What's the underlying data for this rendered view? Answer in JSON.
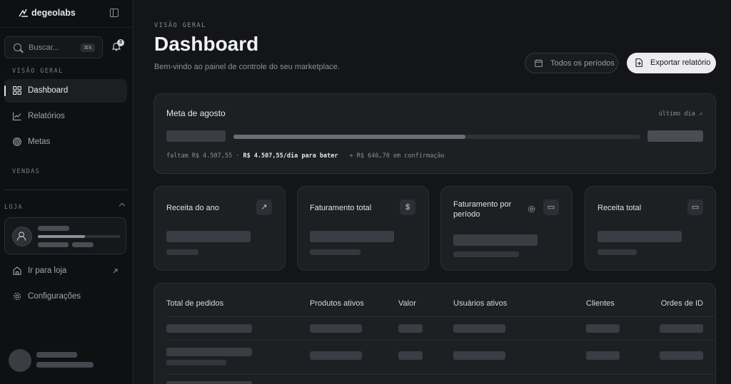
{
  "brand": {
    "name": "degeolabs"
  },
  "search": {
    "placeholder": "Buscar...",
    "shortcut": "⌘K"
  },
  "notifications": {
    "count": "3"
  },
  "sidebar": {
    "section_overview": "VISÃO GERAL",
    "items": [
      {
        "label": "Dashboard",
        "icon": "grid-icon",
        "active": true
      },
      {
        "label": "Relatórios",
        "icon": "chart-icon"
      },
      {
        "label": "Metas",
        "icon": "target-icon"
      }
    ],
    "section_sales": "VENDAS",
    "section_store": "LOJA",
    "footer_items": [
      {
        "label": "Ir para loja",
        "icon": "home-icon"
      },
      {
        "label": "Configurações",
        "icon": "gear-icon"
      }
    ]
  },
  "header": {
    "eyebrow": "VISÃO GERAL",
    "title": "Dashboard",
    "subtitle": "Bem-vindo ao painel de controle do seu marketplace.",
    "period_button": "Todos os períodos",
    "export_button": "Exportar relatório"
  },
  "goal": {
    "title": "Meta de agosto",
    "link": "último dia ↗",
    "progress": 0.57,
    "remaining_prefix": "faltam R$ 4.507,55 · ",
    "per_day": "R$ 4.507,55/dia para bater",
    "confirming": "+ R$ 646,70 em confirmação"
  },
  "stats": [
    {
      "title": "Receita do ano",
      "icon": "trend-up-icon",
      "glyph": "↗"
    },
    {
      "title": "Faturamento total",
      "icon": "dollar-icon",
      "glyph": "$"
    },
    {
      "title": "Faturamento por período",
      "icon": "card-icon",
      "glyph": "▭"
    },
    {
      "title": "Receita total",
      "icon": "card-icon",
      "glyph": "▭"
    }
  ],
  "table": {
    "columns": [
      "Total de pedidos",
      "Produtos ativos",
      "Valor",
      "Usuários ativos",
      "Clientes",
      "Ordes de ID"
    ]
  },
  "colors": {
    "background": "#141517",
    "card": "#1d1f22",
    "accent": "#ececee",
    "skeleton": "#3a3d43"
  }
}
